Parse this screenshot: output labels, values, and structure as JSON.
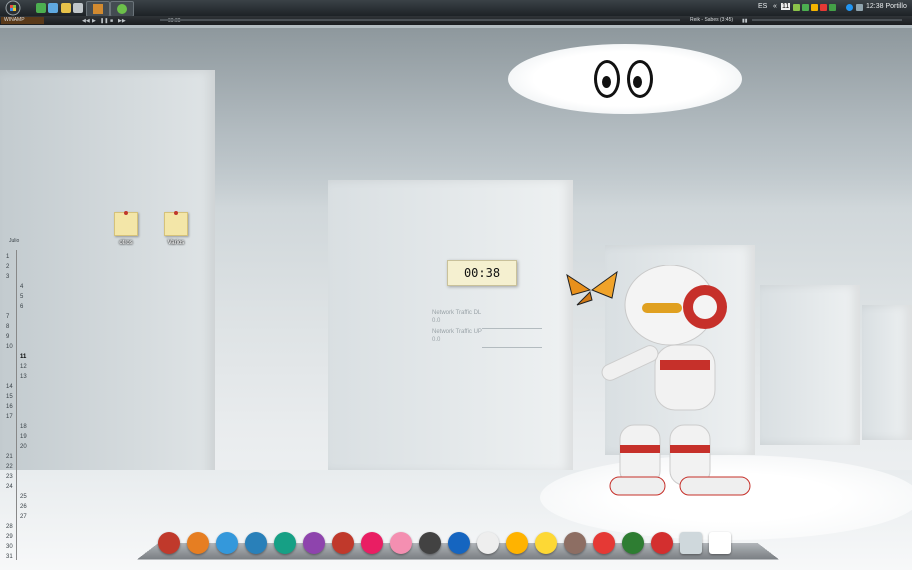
{
  "taskbar": {
    "start_orb": "start-orb-icon",
    "language": "ES",
    "clock": "12:38 Portillo",
    "tray_count": "11"
  },
  "winamp": {
    "title": "WINAMP",
    "time": "00:00",
    "track": "Reik - Sabes (3:45)"
  },
  "desktop_icons": [
    {
      "label": "otros"
    },
    {
      "label": "Varios"
    }
  ],
  "calendar": {
    "month": "Julio",
    "header": "Julio\nun Ø",
    "days": [
      "1",
      "2",
      "3",
      "4",
      "5",
      "6",
      "7",
      "8",
      "9",
      "10",
      "11",
      "12",
      "13",
      "14",
      "15",
      "16",
      "17",
      "18",
      "19",
      "20",
      "21",
      "22",
      "23",
      "24",
      "25",
      "26",
      "27",
      "28",
      "29",
      "30",
      "31"
    ],
    "today": "11"
  },
  "clock_widget": {
    "time": "00:38"
  },
  "network": {
    "down_label": "Network Traffic DL",
    "down_value": "0.0",
    "up_label": "Network Traffic UP",
    "up_value": "0.0"
  },
  "dock": {
    "items": [
      "dock-item-1",
      "dock-item-2",
      "dock-item-3",
      "dock-item-4",
      "dock-item-5",
      "dock-item-6",
      "dock-item-7",
      "dock-item-8",
      "dock-item-9",
      "dock-item-10",
      "dock-item-11",
      "dock-item-12",
      "dock-item-13",
      "dock-item-14",
      "dock-item-15",
      "dock-item-16",
      "dock-item-17",
      "dock-item-18",
      "dock-item-19",
      "dock-item-20"
    ]
  },
  "colors": {
    "taskbar": "#1d2226",
    "accent_red": "#c0392b",
    "note_yellow": "#f3e6a8"
  }
}
